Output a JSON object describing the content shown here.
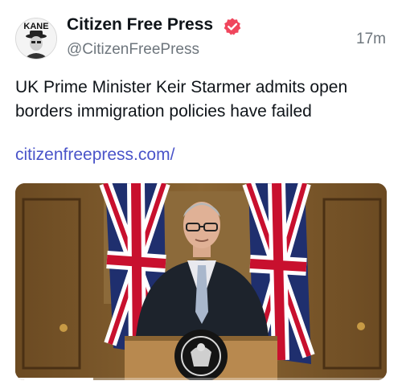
{
  "post": {
    "author_name": "Citizen Free Press",
    "handle": "@CitizenFreePress",
    "timestamp": "17m",
    "text": "UK Prime Minister Keir Starmer admits open borders immigration policies have failed",
    "link": "citizenfreepress.com/",
    "avatar_label": "KANE",
    "verified_icon": "verified-badge-icon",
    "colors": {
      "badge": "#f0465d",
      "link": "#4a54c9",
      "secondary_text": "#6e767d"
    }
  },
  "media": {
    "type": "video",
    "progress": 0.21
  }
}
